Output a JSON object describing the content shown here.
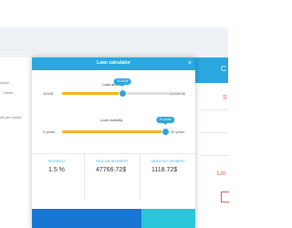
{
  "background": {
    "left_texts": [
      "Value",
      "Deals",
      "06 per month"
    ],
    "right_header_label": "C",
    "right_red_labels": [
      "S",
      "Lin"
    ]
  },
  "modal": {
    "title": "Loan calculator",
    "close_icon": "close-icon",
    "loan_amount": {
      "label": "Loan amount",
      "min_label": "1000$",
      "max_label": "1000000$",
      "bubble": "20 000$",
      "value_fraction": 0.56
    },
    "loan_maturity": {
      "label": "Loan maturity",
      "min_label": "5 years",
      "max_label": "30 years",
      "bubble": "20 years",
      "value_fraction": 0.96
    },
    "results": [
      {
        "label": "INTEREST",
        "value": "1.5 %"
      },
      {
        "label": "PAID ON INTEREST",
        "value": "47766.72$"
      },
      {
        "label": "MONTHLY PAYMENT",
        "value": "1118.72$"
      }
    ]
  },
  "colors": {
    "accent": "#2aa7df",
    "slider_fill": "#f4b41a",
    "footer_dark": "#1976d2",
    "footer_light": "#29c7d9",
    "red": "#e2574c"
  }
}
